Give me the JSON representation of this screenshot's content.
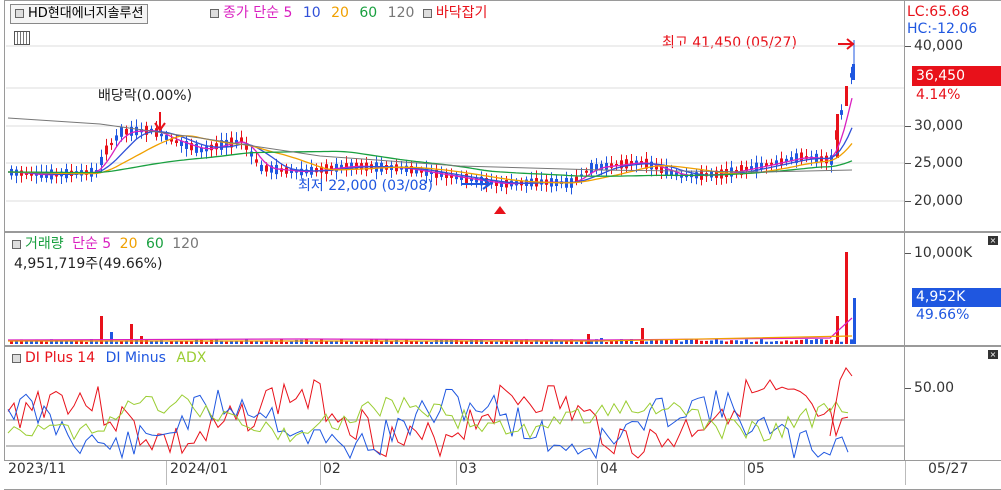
{
  "price_panel": {
    "symbol": "HD현대에너지솔루션",
    "legend_prefix": "종가 단순",
    "ma_values": [
      "5",
      "10",
      "20",
      "60",
      "120"
    ],
    "indicator": "바닥잡기",
    "high_note": "최고 41,450 (05/27)",
    "low_note": "최저 22,000 (03/08)",
    "dividend_note": "배당락(0.00%)",
    "lc": "LC:65.68",
    "hc": "HC:-12.06",
    "price_ticks": [
      "40,000",
      "30,000",
      "25,000",
      "20,000"
    ],
    "current_price": "36,450",
    "change_pct": "4.14%"
  },
  "volume_panel": {
    "legend_prefix": "거래량",
    "legend_mid": "단순 5",
    "ma_values": [
      "20",
      "60",
      "120"
    ],
    "volume_note": "4,951,719주(49.66%)",
    "tick": "10,000K",
    "current_volume": "4,952K",
    "current_pct": "49.66%"
  },
  "dmi_panel": {
    "di_plus": "DI Plus 14",
    "di_minus": "DI Minus",
    "adx": "ADX",
    "tick": "50.00"
  },
  "x_axis": {
    "labels": [
      "2023/11",
      "2024/01",
      "02",
      "03",
      "04",
      "05"
    ],
    "current_date": "05/27"
  },
  "colors": {
    "up": "#e8111a",
    "down": "#1f57e0",
    "ma5": "#d91fc0",
    "ma10": "#3050d8",
    "ma20": "#f0a000",
    "ma60": "#1aa040",
    "ma120": "#777777",
    "adx": "#9acd32"
  }
}
